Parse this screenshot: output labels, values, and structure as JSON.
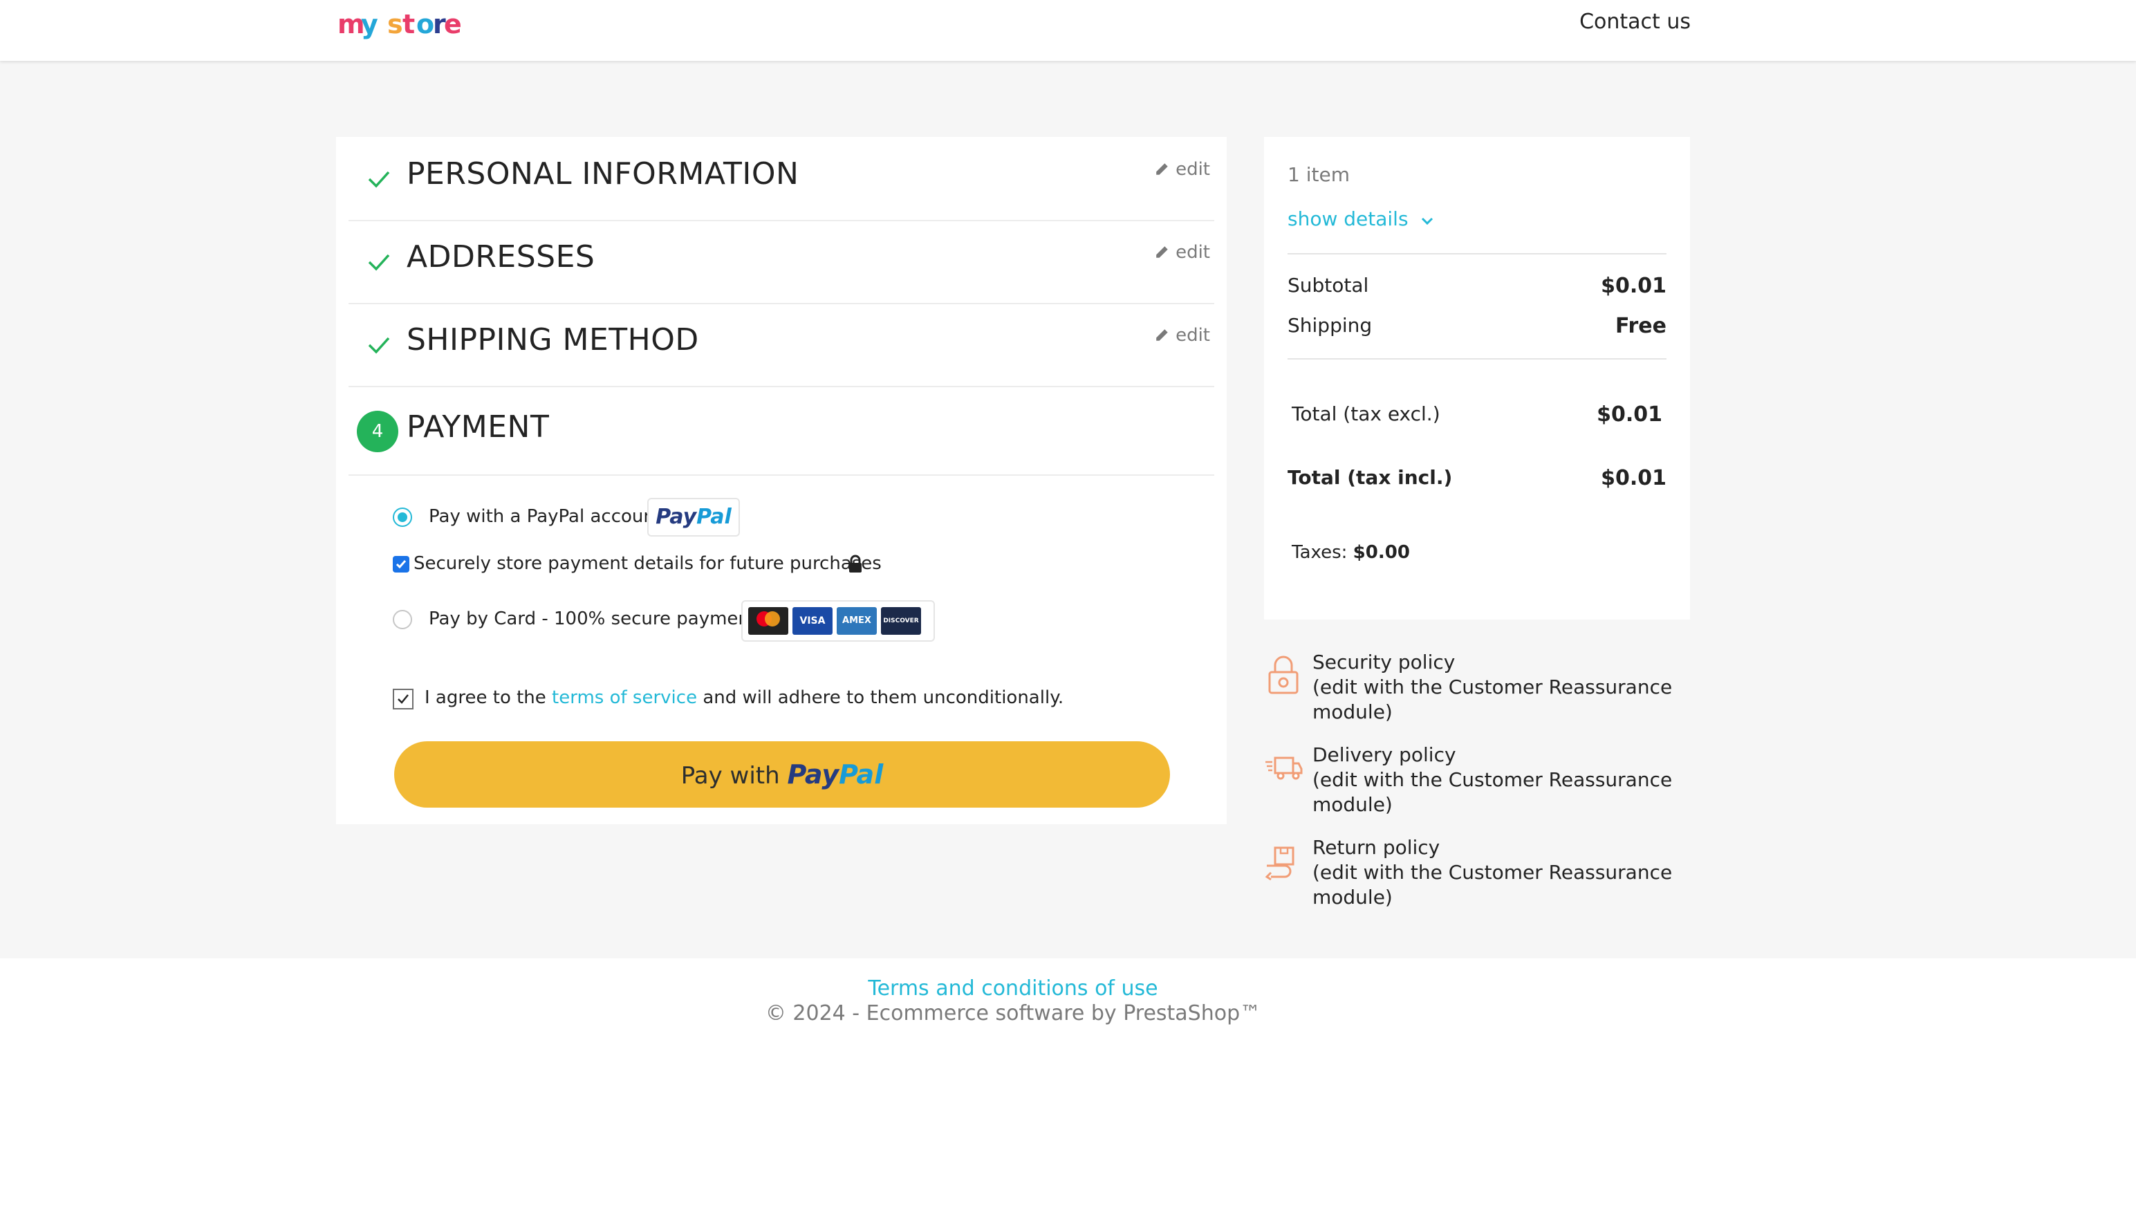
{
  "header": {
    "logo_text": "my store",
    "contact_label": "Contact us"
  },
  "steps": [
    {
      "title": "PERSONAL INFORMATION",
      "status": "complete",
      "edit_label": "edit"
    },
    {
      "title": "ADDRESSES",
      "status": "complete",
      "edit_label": "edit"
    },
    {
      "title": "SHIPPING METHOD",
      "status": "complete",
      "edit_label": "edit"
    },
    {
      "number": "4",
      "title": "PAYMENT",
      "status": "current"
    }
  ],
  "payment": {
    "paypal_option_label": "Pay with a PayPal account",
    "paypal_badge": {
      "part1": "Pay",
      "part2": "Pal"
    },
    "store_details_label": "Securely store payment details for future purchases",
    "card_option_label": "Pay by Card - 100% secure payments",
    "card_brands": [
      "mastercard",
      "VISA",
      "AMEX",
      "DISCOVER"
    ],
    "terms": {
      "before": "I agree to the",
      "link": "terms of service",
      "after": "and will adhere to them unconditionally."
    },
    "button": {
      "prefix": "Pay with",
      "brand1": "Pay",
      "brand2": "Pal"
    }
  },
  "summary": {
    "items_count": "1 item",
    "show_details": "show details",
    "subtotal_label": "Subtotal",
    "subtotal_value": "$0.01",
    "shipping_label": "Shipping",
    "shipping_value": "Free",
    "total_excl_label": "Total (tax excl.)",
    "total_excl_value": "$0.01",
    "total_incl_label": "Total (tax incl.)",
    "total_incl_value": "$0.01",
    "taxes_label": "Taxes:",
    "taxes_value": "$0.00"
  },
  "reassurance": [
    {
      "title": "Security policy",
      "desc": "(edit with the Customer Reassurance module)"
    },
    {
      "title": "Delivery policy",
      "desc": "(edit with the Customer Reassurance module)"
    },
    {
      "title": "Return policy",
      "desc": "(edit with the Customer Reassurance module)"
    }
  ],
  "footer": {
    "terms_link": "Terms and conditions of use",
    "copyright": "© 2024 - Ecommerce software by PrestaShop™"
  },
  "colors": {
    "accent": "#24b9d7",
    "success": "#24b35a",
    "paypal_button": "#f2ba36",
    "reassurance_icon": "#f19d76"
  }
}
